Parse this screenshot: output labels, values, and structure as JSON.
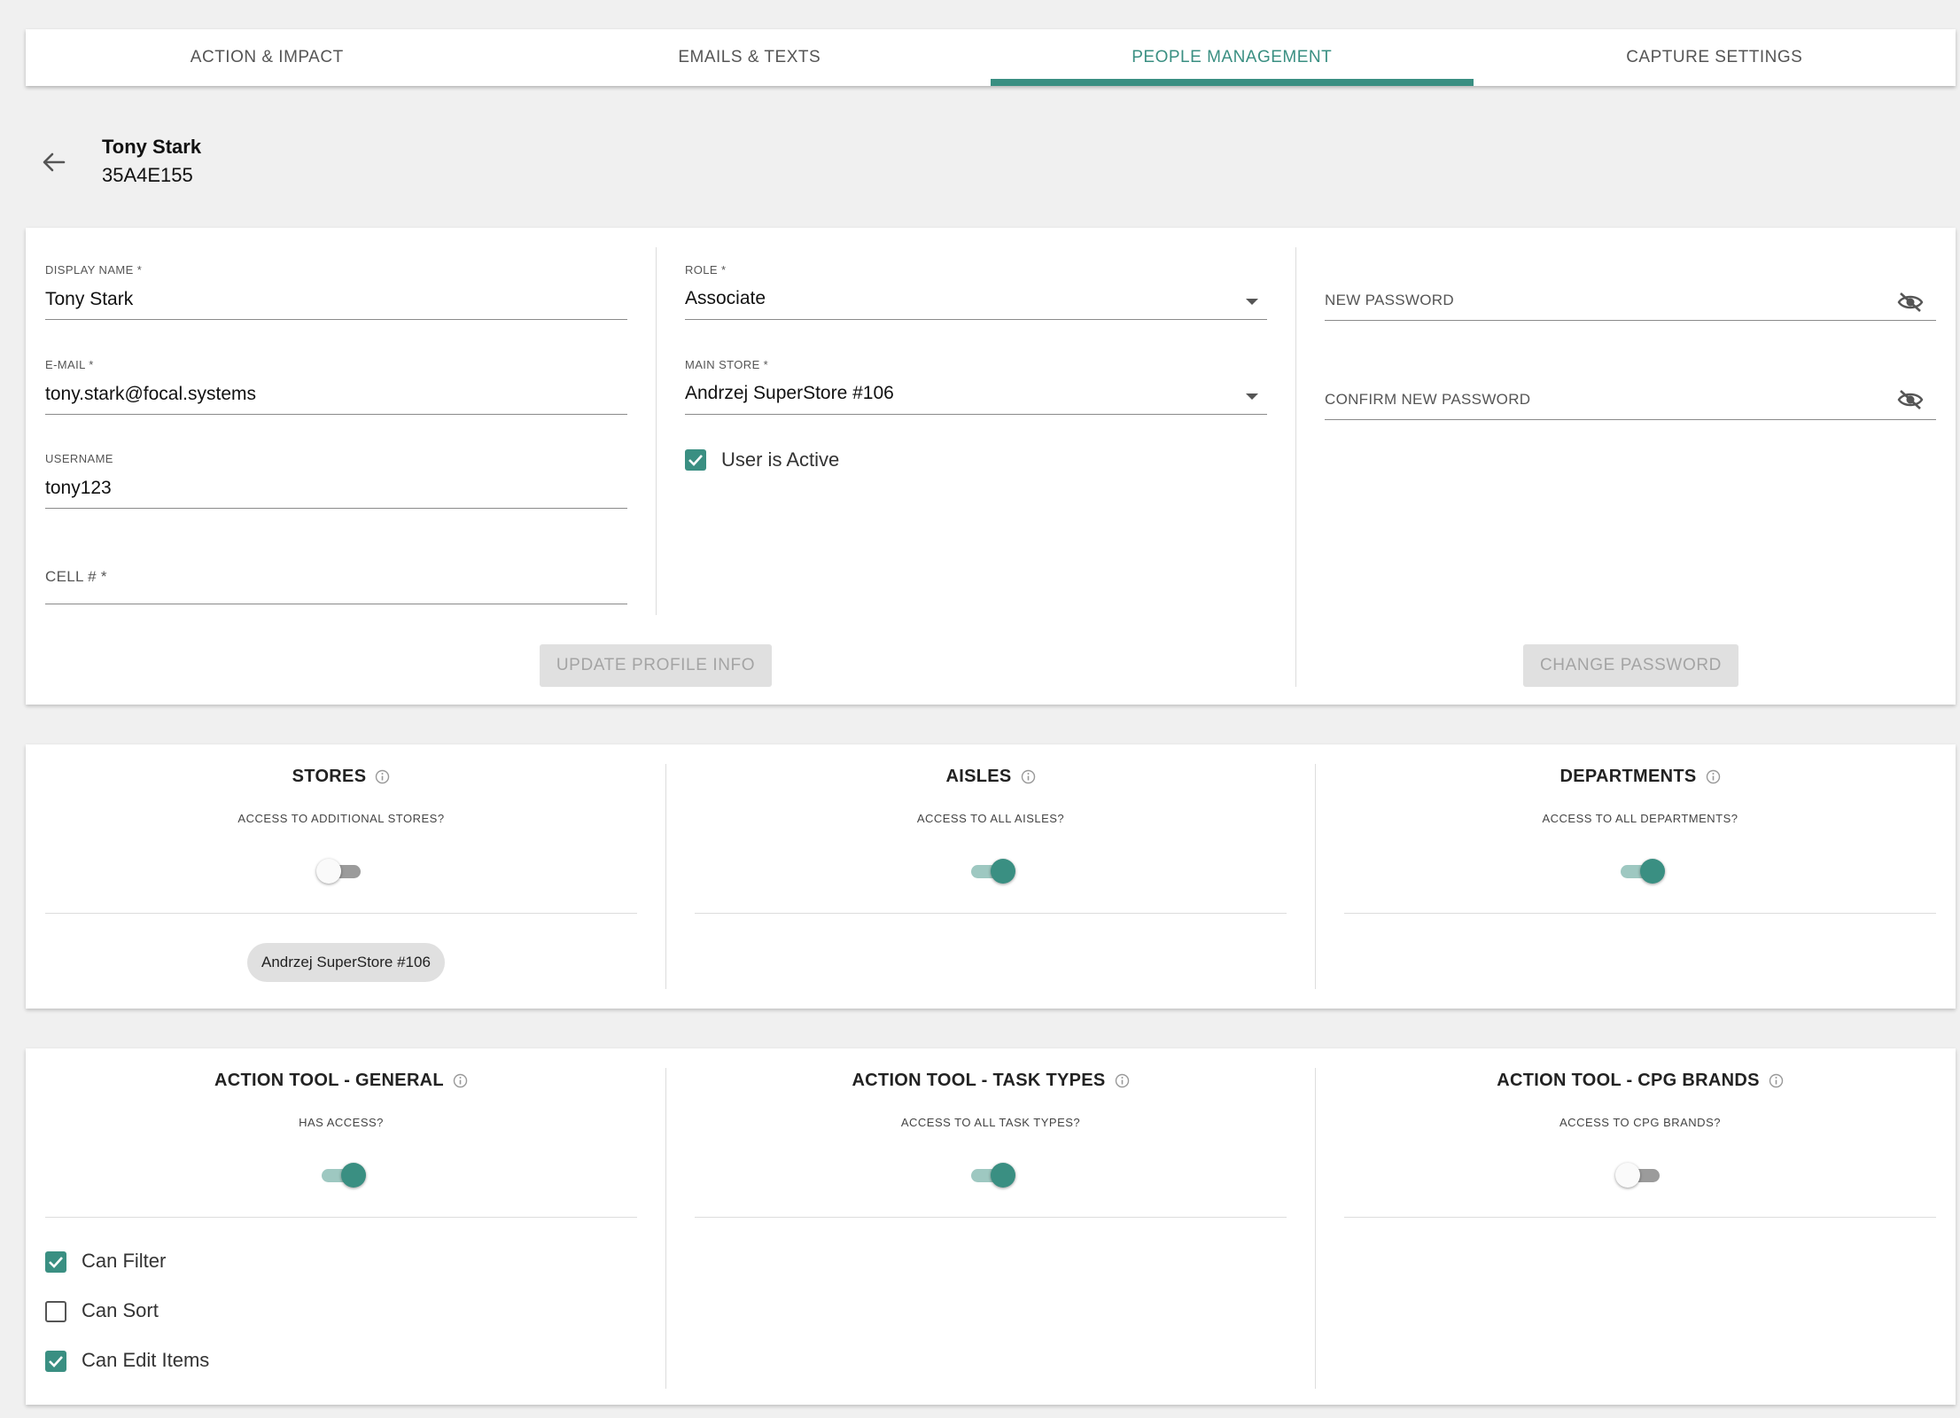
{
  "tabs": [
    {
      "label": "ACTION & IMPACT"
    },
    {
      "label": "EMAILS & TEXTS"
    },
    {
      "label": "PEOPLE MANAGEMENT"
    },
    {
      "label": "CAPTURE SETTINGS"
    }
  ],
  "active_tab": "PEOPLE MANAGEMENT",
  "profile": {
    "name": "Tony Stark",
    "id": "35A4E155"
  },
  "form": {
    "display_name": {
      "label": "DISPLAY NAME *",
      "value": "Tony Stark"
    },
    "email": {
      "label": "E-MAIL *",
      "value": "tony.stark@focal.systems"
    },
    "username": {
      "label": "USERNAME",
      "value": "tony123"
    },
    "cell": {
      "label": "CELL # *",
      "value": ""
    },
    "role": {
      "label": "ROLE *",
      "value": "Associate"
    },
    "main_store": {
      "label": "MAIN STORE *",
      "value": "Andrzej SuperStore #106"
    },
    "user_active": {
      "label": "User is Active",
      "checked": true
    },
    "new_password": {
      "label": "NEW PASSWORD"
    },
    "confirm_password": {
      "label": "CONFIRM NEW PASSWORD"
    },
    "update_button": "UPDATE PROFILE INFO",
    "change_password_button": "CHANGE PASSWORD"
  },
  "access": {
    "stores": {
      "title": "STORES",
      "question": "ACCESS TO ADDITIONAL STORES?",
      "enabled": false,
      "chips": [
        "Andrzej SuperStore #106"
      ]
    },
    "aisles": {
      "title": "AISLES",
      "question": "ACCESS TO ALL AISLES?",
      "enabled": true
    },
    "departments": {
      "title": "DEPARTMENTS",
      "question": "ACCESS TO ALL DEPARTMENTS?",
      "enabled": true
    }
  },
  "action_tool": {
    "general": {
      "title": "ACTION TOOL - GENERAL",
      "question": "HAS ACCESS?",
      "enabled": true,
      "permissions": [
        {
          "label": "Can Filter",
          "checked": true
        },
        {
          "label": "Can Sort",
          "checked": false
        },
        {
          "label": "Can Edit Items",
          "checked": true
        }
      ]
    },
    "task_types": {
      "title": "ACTION TOOL - TASK TYPES",
      "question": "ACCESS TO ALL TASK TYPES?",
      "enabled": true
    },
    "cpg_brands": {
      "title": "ACTION TOOL - CPG BRANDS",
      "question": "ACCESS TO CPG BRANDS?",
      "enabled": false
    }
  },
  "colors": {
    "accent": "#3a8f82",
    "background": "#f0f0f0",
    "button_disabled": "#e0e0e0"
  }
}
